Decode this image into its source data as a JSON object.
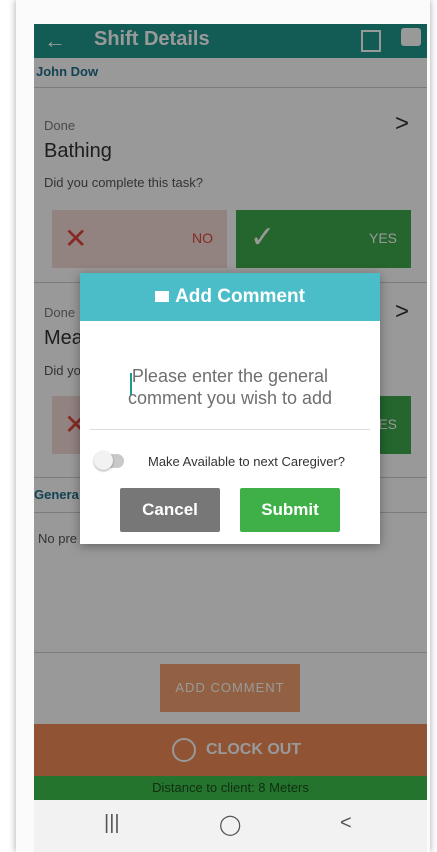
{
  "header": {
    "title": "Shift Details",
    "back_icon": "arrow-left-icon"
  },
  "client_name": "John Dow",
  "tasks": [
    {
      "status": "Done",
      "name": "Bathing",
      "question": "Did you complete this task?",
      "no_label": "NO",
      "yes_label": "YES"
    },
    {
      "status": "Done",
      "name": "Mea",
      "question": "Did yo",
      "yes_label": "ES"
    }
  ],
  "general_section": {
    "label": "Genera",
    "no_previous": "No pre"
  },
  "add_comment_label": "ADD COMMENT",
  "clock_out_label": "CLOCK OUT",
  "distance_text": "Distance to client: 8 Meters",
  "modal": {
    "title": "Add Comment",
    "placeholder": "Please enter the general comment you wish to add",
    "toggle_label": "Make Available to next Caregiver?",
    "toggle_on": false,
    "cancel_label": "Cancel",
    "submit_label": "Submit"
  },
  "nav": {
    "recents": "|||",
    "home": "◯",
    "back": "<"
  },
  "colors": {
    "primary": "#1f9a8e",
    "modal_header": "#4bbdc8",
    "success": "#3faf48",
    "cancel": "#777777",
    "accent": "#f08a55",
    "danger": "#e0463d"
  }
}
